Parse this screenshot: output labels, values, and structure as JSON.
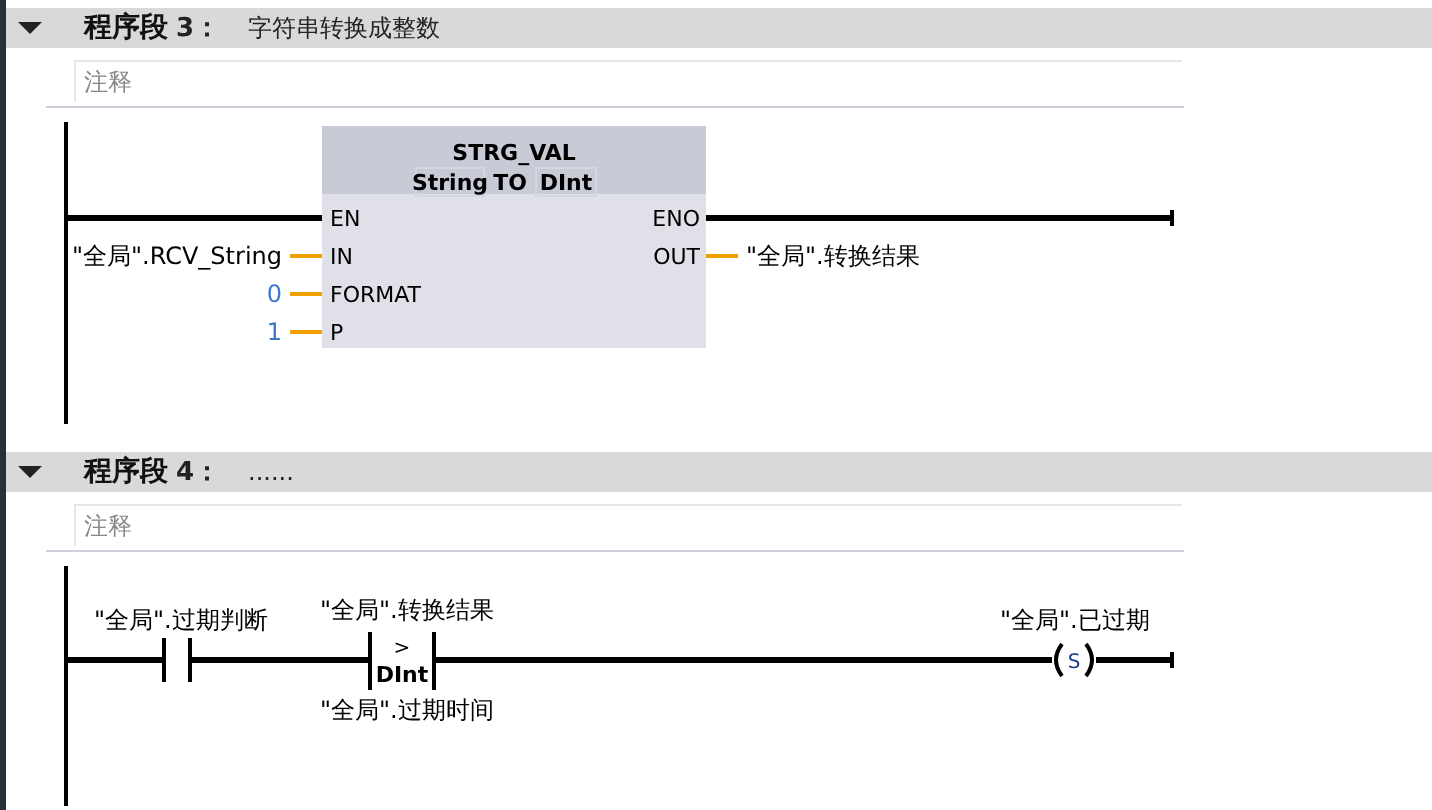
{
  "networks": [
    {
      "label": "程序段",
      "number": "3：",
      "title": "字符串转换成整数",
      "expanded": true,
      "comment": {
        "placeholder": "注释"
      },
      "kind": "box",
      "block": {
        "name": "STRG_VAL",
        "type_from": "String",
        "to": "TO",
        "type_to": "DInt",
        "inputs": [
          {
            "pin": "EN",
            "kind": "power"
          },
          {
            "pin": "IN",
            "kind": "tag",
            "operand": "\"全局\".RCV_String"
          },
          {
            "pin": "FORMAT",
            "kind": "constant",
            "operand": "0"
          },
          {
            "pin": "P",
            "kind": "constant",
            "operand": "1"
          }
        ],
        "outputs": [
          {
            "pin": "ENO",
            "kind": "power"
          },
          {
            "pin": "OUT",
            "kind": "tag",
            "operand": "\"全局\".转换结果"
          }
        ]
      }
    },
    {
      "label": "程序段",
      "number": "4：",
      "title": "......",
      "expanded": true,
      "comment": {
        "placeholder": "注释"
      },
      "kind": "rung",
      "elements": [
        {
          "kind": "contact",
          "operand": "\"全局\".过期判断"
        },
        {
          "kind": "compare",
          "operator": ">",
          "type": "DInt",
          "operand_top": "\"全局\".转换结果",
          "operand_bottom": "\"全局\".过期时间"
        },
        {
          "kind": "coil",
          "letter": "S",
          "operand": "\"全局\".已过期"
        }
      ]
    }
  ]
}
